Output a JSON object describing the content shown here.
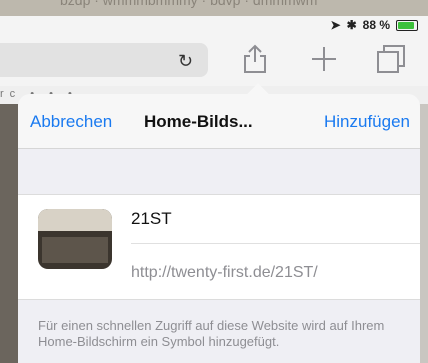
{
  "background": {
    "top_text": "bzdp · wmmmbmmmy · bdvp · dmmmwm"
  },
  "status_bar": {
    "battery_percent": "88 %",
    "battery_fraction": 0.88,
    "battery_color": "#3cc13b"
  },
  "toolbar": {
    "icons": [
      "reload-icon",
      "share-icon",
      "new-tab-icon",
      "tabs-icon"
    ]
  },
  "bookmarks": {
    "text": "rc  •  •  •"
  },
  "popover": {
    "cancel_label": "Abbrechen",
    "title": "Home-Bilds...",
    "add_label": "Hinzufügen",
    "accent_color": "#1a7af0",
    "entry": {
      "name": "21ST",
      "url": "http://twenty-first.de/21ST/"
    },
    "info_text": "Für einen schnellen Zugriff auf diese Website wird auf Ihrem Home-Bildschirm ein Symbol hinzugefügt."
  }
}
